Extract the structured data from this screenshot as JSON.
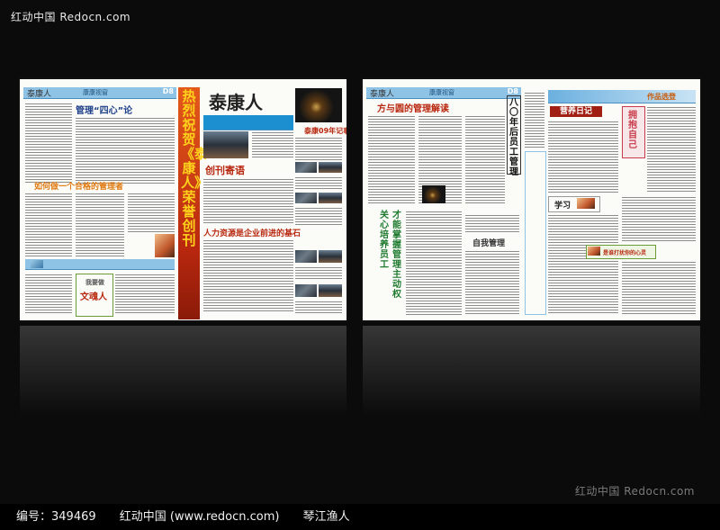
{
  "watermark": {
    "top_left": "红动中国  Redocn.com",
    "bottom_right": "红动中国  Redocn.com"
  },
  "footer": {
    "id_label": "编号：349469",
    "site": "红动中国 (www.redocn.com)",
    "author": "琴江渔人"
  },
  "left_spread": {
    "inner_page": {
      "masthead": "泰康人",
      "section": "康康视窗",
      "page_no": "D8",
      "headline_1": "管理“四心”论",
      "headline_2": "如何做一个合格的管理者",
      "sidebar_label": "我要做",
      "sidebar_title": "文魂人"
    },
    "vertical_band": "热烈祝贺《泰康人》荣誉创刊",
    "front_page": {
      "masthead": "泰康人",
      "headline_1": "创刊寄语",
      "headline_2": "泰康09年记事录",
      "headline_3": "人力资源是企业前进的基石"
    }
  },
  "right_spread": {
    "left_page": {
      "masthead": "泰康人",
      "section": "康康视窗",
      "page_no": "D8",
      "headline_1": "方与圆的管理解读",
      "headline_2": "八〇年后员工管理",
      "headline_3": "自我管理",
      "vertical_green_1": "关心培养员工",
      "vertical_green_2": "才能掌握管理主动权"
    },
    "right_page": {
      "section": "作品选登",
      "headline_1": "营养日记",
      "headline_2": "拥抱自己",
      "headline_3": "学习",
      "headline_4": "是谁打扰你的心灵"
    }
  }
}
